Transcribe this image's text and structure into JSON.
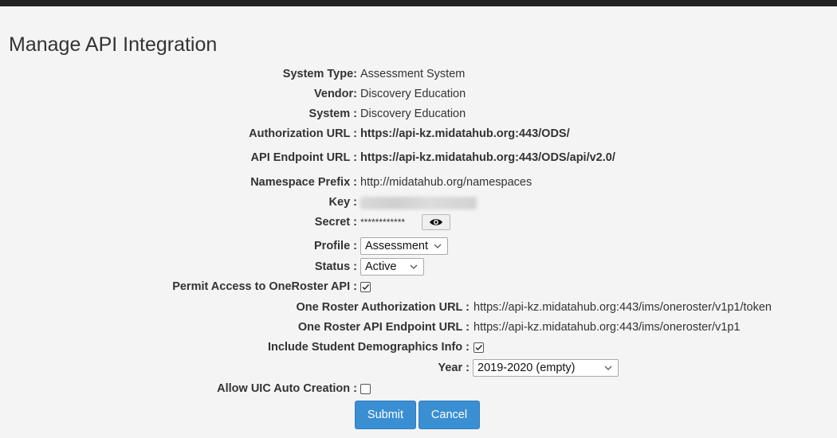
{
  "page": {
    "title": "Manage API Integration"
  },
  "fields": {
    "system_type": {
      "label": "System Type:",
      "value": "Assessment System"
    },
    "vendor": {
      "label": "Vendor:",
      "value": "Discovery Education"
    },
    "system": {
      "label": "System :",
      "value": "Discovery Education"
    },
    "authorization_url": {
      "label": "Authorization URL :",
      "value": "https://api-kz.midatahub.org:443/ODS/"
    },
    "api_endpoint_url": {
      "label": "API Endpoint URL :",
      "value": "https://api-kz.midatahub.org:443/ODS/api/v2.0/"
    },
    "namespace_prefix": {
      "label": "Namespace Prefix :",
      "value": "http://midatahub.org/namespaces"
    },
    "key": {
      "label": "Key :"
    },
    "secret": {
      "label": "Secret :",
      "value": "************"
    },
    "profile": {
      "label": "Profile :",
      "selected": "Assessment"
    },
    "status": {
      "label": "Status :",
      "selected": "Active"
    },
    "permit_oneroster": {
      "label": "Permit Access to OneRoster API :",
      "checked": true
    },
    "oneroster_auth_url": {
      "label": "One Roster Authorization URL :",
      "value": "https://api-kz.midatahub.org:443/ims/oneroster/v1p1/token"
    },
    "oneroster_endpoint_url": {
      "label": "One Roster API Endpoint URL :",
      "value": "https://api-kz.midatahub.org:443/ims/oneroster/v1p1"
    },
    "include_demographics": {
      "label": "Include Student Demographics Info :",
      "checked": true
    },
    "year": {
      "label": "Year :",
      "selected": "2019-2020 (empty)"
    },
    "allow_uic": {
      "label": "Allow UIC Auto Creation :",
      "checked": false
    }
  },
  "actions": {
    "submit_label": "Submit",
    "cancel_label": "Cancel"
  },
  "colors": {
    "primary_button": "#3a8fd3",
    "top_bar": "#222222",
    "background": "#f4f4f4"
  },
  "icons": {
    "reveal_secret": "eye-icon",
    "dropdown": "chevron-down-icon",
    "checkbox": "checkmark-icon"
  }
}
